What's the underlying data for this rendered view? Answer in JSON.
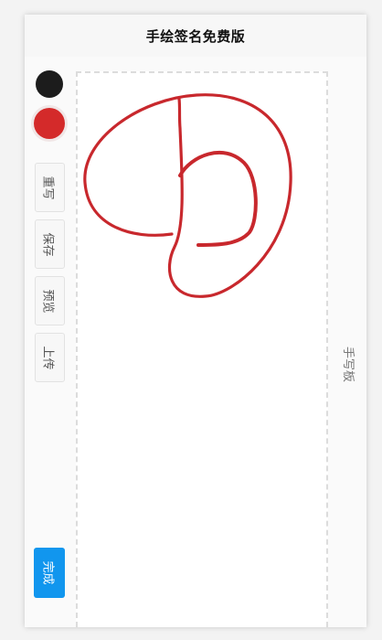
{
  "header": {
    "title": "手绘签名免费版"
  },
  "palette": {
    "colors": [
      {
        "name": "black",
        "hex": "#1c1c1c"
      },
      {
        "name": "red",
        "hex": "#d42a2a",
        "selected": true
      }
    ]
  },
  "toolbar": {
    "rewrite_label": "重写",
    "save_label": "保存",
    "preview_label": "预览",
    "upload_label": "上传",
    "done_label": "完成"
  },
  "canvas": {
    "label": "手写板",
    "stroke_color": "#c8282d"
  }
}
